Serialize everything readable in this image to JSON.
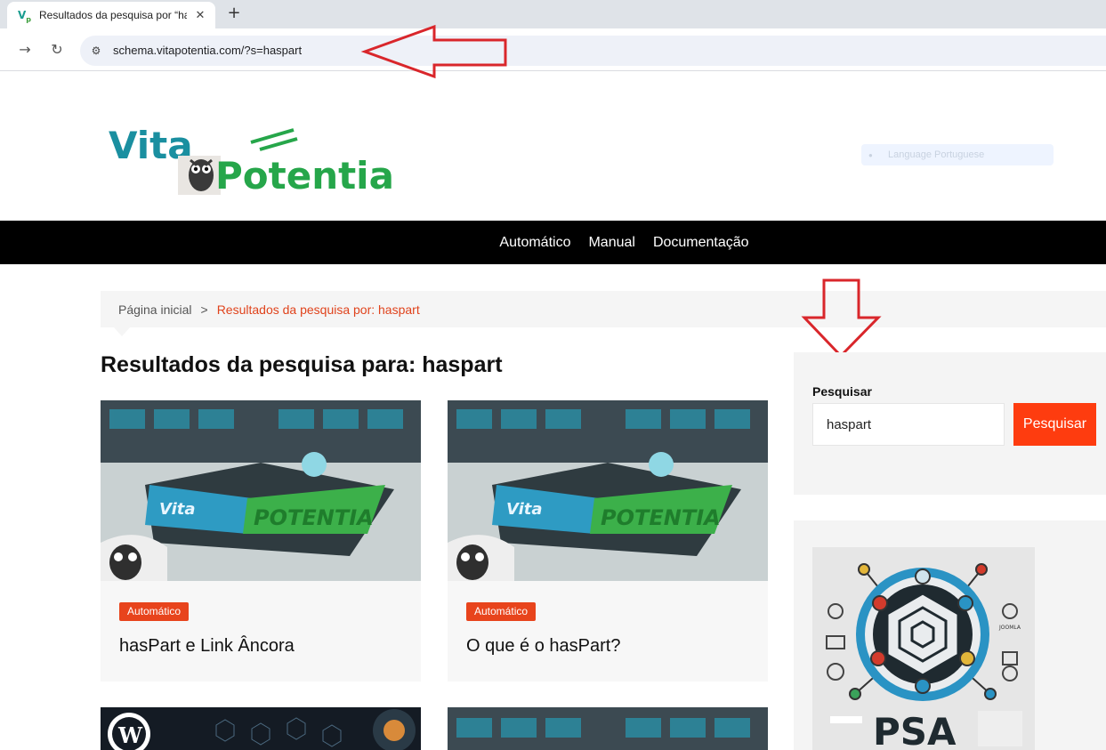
{
  "browser": {
    "tab_title": "Resultados da pesquisa por “ha",
    "tab_favicon": "VP",
    "url": "schema.vitapotentia.com/?s=haspart",
    "icons": [
      "back-arrow-icon",
      "reload-icon",
      "site-info-icon",
      "close-icon",
      "plus-icon"
    ]
  },
  "site": {
    "logo_word_1": "Vita",
    "logo_word_2": "Potentia",
    "language_selector": "Language Portuguese",
    "nav": [
      "Automático",
      "Manual",
      "Documentação"
    ]
  },
  "breadcrumb": {
    "home": "Página inicial",
    "separator": ">",
    "current": "Resultados da pesquisa por: haspart"
  },
  "results": {
    "heading": "Resultados da pesquisa para: haspart",
    "cards": [
      {
        "category": "Automático",
        "title": "hasPart e Link Âncora",
        "image_text_1": "Vita",
        "image_text_2": "POTENTIA"
      },
      {
        "category": "Automático",
        "title": "O que é o hasPart?",
        "image_text_1": "Vita",
        "image_text_2": "POTENTIA"
      }
    ]
  },
  "sidebar": {
    "search_label": "Pesquisar",
    "search_value": "haspart",
    "search_button": "Pesquisar",
    "psa_image_text": "PSA",
    "psa_image_label": "JOOMLA"
  },
  "colors": {
    "accent": "#fe3c0f",
    "badge": "#e8441c",
    "annotation_arrow": "#d9262b",
    "nav_bg": "#000000"
  }
}
